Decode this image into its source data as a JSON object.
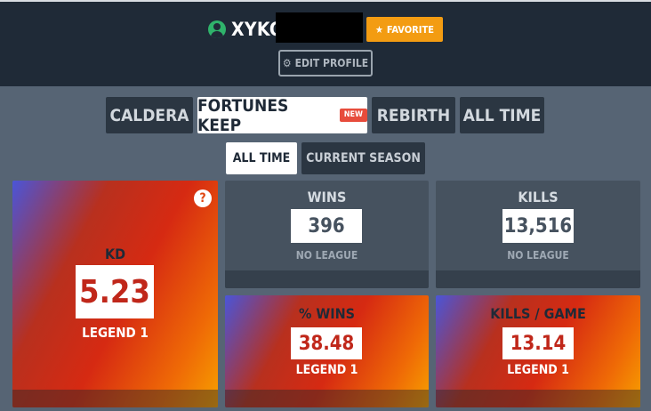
{
  "profile": {
    "username": "XYKO",
    "favorite_label": "FAVORITE",
    "edit_label": "EDIT PROFILE"
  },
  "map_tabs": [
    {
      "label": "CALDERA",
      "active": false
    },
    {
      "label": "FORTUNES KEEP",
      "active": true,
      "badge": "NEW"
    },
    {
      "label": "REBIRTH",
      "active": false
    },
    {
      "label": "ALL TIME",
      "active": false
    }
  ],
  "period_tabs": [
    {
      "label": "ALL TIME",
      "active": true
    },
    {
      "label": "CURRENT SEASON",
      "active": false
    }
  ],
  "stats": {
    "kd": {
      "label": "KD",
      "value": "5.23",
      "rank": "LEGEND 1",
      "help": "?"
    },
    "wins": {
      "label": "WINS",
      "value": "396",
      "rank": "NO LEAGUE"
    },
    "kills": {
      "label": "KILLS",
      "value": "13,516",
      "rank": "NO LEAGUE"
    },
    "win_pct": {
      "label": "% WINS",
      "value": "38.48",
      "rank": "LEGEND 1"
    },
    "kills_per_game": {
      "label": "KILLS / GAME",
      "value": "13.14",
      "rank": "LEGEND 1"
    }
  },
  "colors": {
    "header_bg": "#1f2a37",
    "page_bg": "#566474",
    "favorite": "#f39c12",
    "online": "#2fb36b",
    "new_badge": "#e74c3c",
    "value_text_red": "#c0271a",
    "value_text_gray": "#46525f"
  }
}
